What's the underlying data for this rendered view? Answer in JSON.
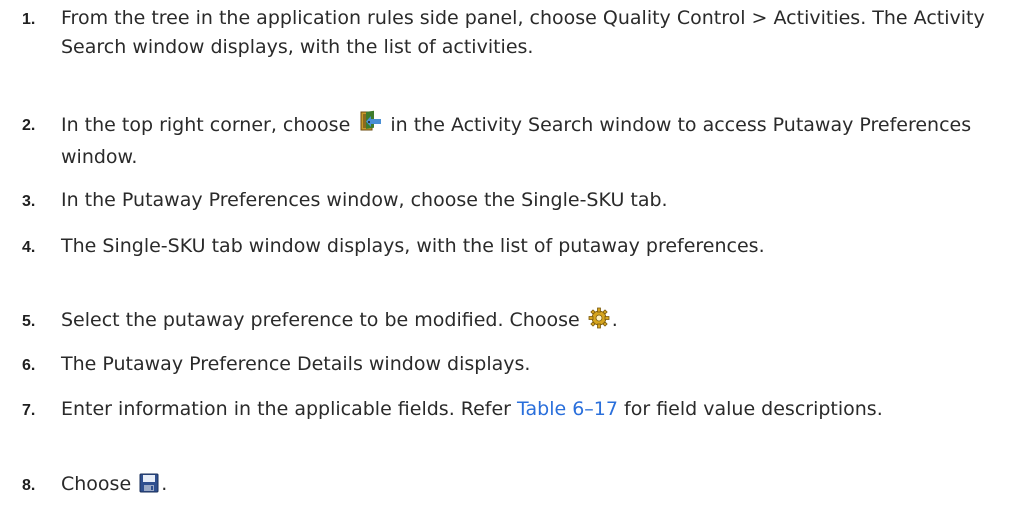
{
  "steps": [
    {
      "number": "1.",
      "text": "From the tree in the application rules side panel, choose Quality Control > Activities. The Activity Search window displays, with the list of activities."
    },
    {
      "number": "2.",
      "before": "In the top right corner, choose",
      "icon": "putaway-preferences-icon",
      "after": "in the Activity Search window to access Putaway Preferences window."
    },
    {
      "number": "3.",
      "text": "In the Putaway Preferences window, choose the Single-SKU tab."
    },
    {
      "number": "4.",
      "text": "The Single-SKU tab window displays, with the list of putaway preferences."
    },
    {
      "number": "5.",
      "before": "Select the putaway preference to be modified. Choose",
      "icon": "gear-icon",
      "after": "."
    },
    {
      "number": "6.",
      "text": "The Putaway Preference Details window displays."
    },
    {
      "number": "7.",
      "before": "Enter information in the applicable fields. Refer",
      "link": "Table 6–17",
      "after": "for field value descriptions."
    },
    {
      "number": "8.",
      "before": "Choose",
      "icon": "save-icon",
      "after": "."
    }
  ],
  "colors": {
    "text": "#2a2a2a",
    "link": "#2a6fdb"
  }
}
